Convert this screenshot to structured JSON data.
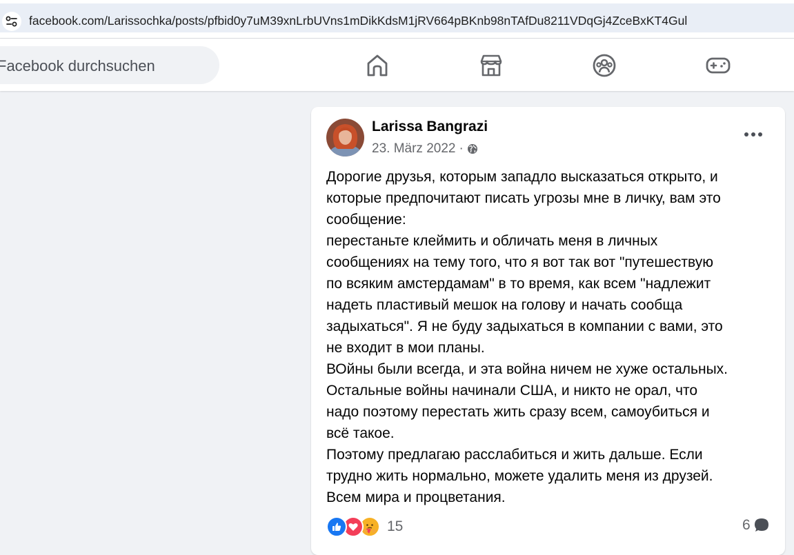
{
  "browser": {
    "url": "facebook.com/Larissochka/posts/pfbid0y7uM39xnLrbUVns1mDikKdsM1jRV664pBKnb98nTAfDu8211VDqGj4ZceBxKT4Gul",
    "site_info_icon": "tune-icon"
  },
  "header": {
    "search_placeholder": "Facebook durchsuchen",
    "nav": [
      {
        "name": "home",
        "icon": "home-icon"
      },
      {
        "name": "marketplace",
        "icon": "marketplace-icon"
      },
      {
        "name": "groups",
        "icon": "groups-icon"
      },
      {
        "name": "gaming",
        "icon": "gamepad-icon"
      }
    ]
  },
  "post": {
    "author": "Larissa Bangrazi",
    "date": "23. März 2022",
    "separator": "·",
    "audience_icon": "globe-icon",
    "lines": [
      "Дорогие друзья, которым западло высказаться открыто, и",
      "которые предпочитают писать угрозы мне в личку, вам это",
      "сообщение:",
      "перестаньте клеймить и обличать меня в личных",
      "сообщениях на тему того, что я вот так вот \"путешествую",
      "по всяким амстердамам\" в то время, как всем \"надлежит",
      "надеть пластивый мешок на голову и начать сообща",
      "задыхаться\".  Я не буду задыхаться в компании с вами, это",
      "не входит в мои планы.",
      "ВОйны были всегда, и эта война ничем не хуже остальных.",
      "Остальные войны начинали США, и никто не орал, что",
      "надо поэтому перестать жить сразу всем, самоубиться и",
      "всё такое.",
      "Поэтому предлагаю расслабиться и жить дальше. Если",
      "трудно жить нормально, можете удалить меня из друзей.",
      "Всем мира и процветания."
    ],
    "reactions": {
      "icons": [
        "like-icon",
        "love-icon",
        "care-icon"
      ],
      "count": "15"
    },
    "comments": {
      "count": "6",
      "icon": "comment-icon"
    }
  },
  "colors": {
    "facebook_blue": "#1877f2",
    "love_red": "#f33e58",
    "care_yellow": "#f7b125",
    "secondary_text": "#65676b",
    "background": "#f0f2f5"
  }
}
